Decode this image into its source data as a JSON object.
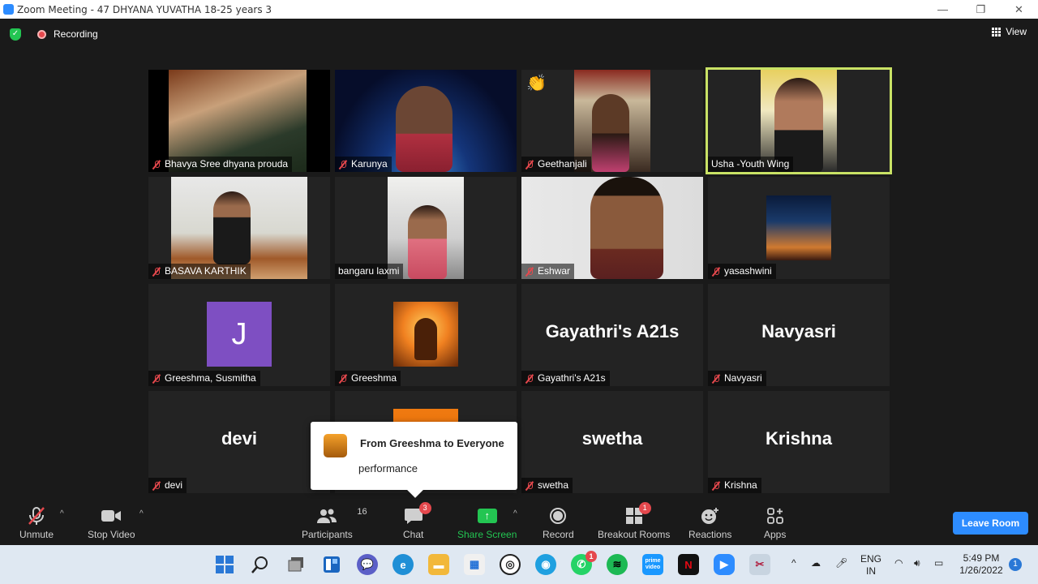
{
  "window": {
    "title": "Zoom Meeting - 47 DHYANA YUVATHA 18-25 years  3"
  },
  "topbar": {
    "recording_label": "Recording",
    "view_label": "View"
  },
  "participants": [
    {
      "name": "Bhavya Sree dhyana prouda",
      "muted": true,
      "display": "video"
    },
    {
      "name": "Karunya",
      "muted": true,
      "display": "video"
    },
    {
      "name": "Geethanjali",
      "muted": true,
      "display": "video",
      "reaction": "👏"
    },
    {
      "name": "Usha -Youth Wing",
      "muted": false,
      "display": "video",
      "active_speaker": true
    },
    {
      "name": "BASAVA KARTHIK",
      "muted": true,
      "display": "video"
    },
    {
      "name": "bangaru laxmi",
      "muted": false,
      "display": "video"
    },
    {
      "name": "Eshwar",
      "muted": true,
      "display": "video"
    },
    {
      "name": "yasashwini",
      "muted": true,
      "display": "image"
    },
    {
      "name": "Greeshma, Susmitha",
      "muted": true,
      "display": "avatar",
      "avatar_letter": "J"
    },
    {
      "name": "Greeshma",
      "muted": true,
      "display": "image"
    },
    {
      "name": "Gayathri's A21s",
      "muted": true,
      "display": "name",
      "big_name": "Gayathri's A21s"
    },
    {
      "name": "Navyasri",
      "muted": true,
      "display": "name",
      "big_name": "Navyasri"
    },
    {
      "name": "devi",
      "muted": true,
      "display": "name",
      "big_name": "devi"
    },
    {
      "name": "",
      "muted": false,
      "display": "image"
    },
    {
      "name": "swetha",
      "muted": true,
      "display": "name",
      "big_name": "swetha"
    },
    {
      "name": "Krishna",
      "muted": true,
      "display": "name",
      "big_name": "Krishna"
    }
  ],
  "chat_notification": {
    "from": "From Greeshma to Everyone",
    "message": "performance"
  },
  "toolbar": {
    "unmute": "Unmute",
    "stop_video": "Stop Video",
    "participants": "Participants",
    "participants_count": "16",
    "chat": "Chat",
    "chat_badge": "3",
    "share_screen": "Share Screen",
    "record": "Record",
    "breakout_rooms": "Breakout Rooms",
    "breakout_badge": "1",
    "reactions": "Reactions",
    "apps": "Apps",
    "leave": "Leave Room"
  },
  "taskbar": {
    "whatsapp_badge": "1",
    "prime_label": "prime video",
    "lang_line1": "ENG",
    "lang_line2": "IN",
    "time": "5:49 PM",
    "date": "1/26/2022",
    "notification_count": "1"
  },
  "colors": {
    "accent": "#2d8cff",
    "active_border": "#c9e265",
    "muted_red": "#e5484d",
    "share_green": "#23c552"
  }
}
